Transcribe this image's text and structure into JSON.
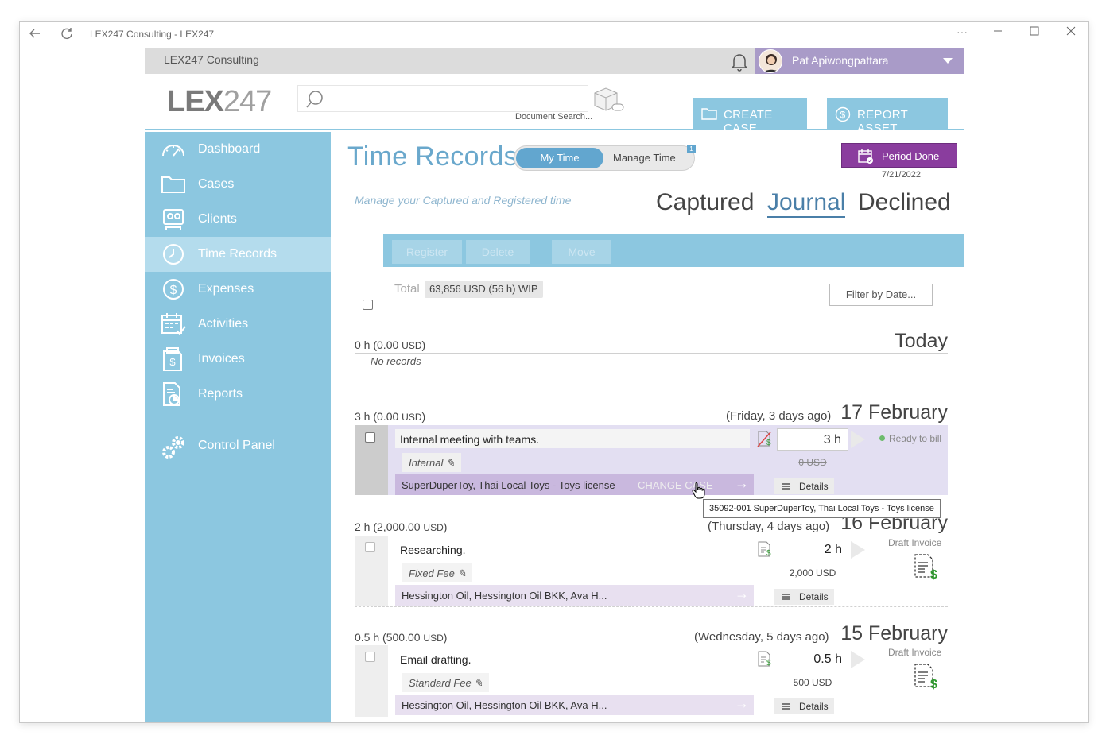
{
  "window": {
    "title": "LEX247 Consulting - LEX247"
  },
  "topbar": {
    "org": "LEX247 Consulting",
    "user": "Pat Apiwongpattara"
  },
  "header": {
    "logo_bold": "LEX",
    "logo_light": "247",
    "search_placeholder": "",
    "doc_search_label": "Document Search...",
    "create_case": "CREATE CASE",
    "report_asset": "REPORT ASSET"
  },
  "sidebar": {
    "items": [
      {
        "label": "Dashboard",
        "icon": "dashboard-icon"
      },
      {
        "label": "Cases",
        "icon": "folder-icon"
      },
      {
        "label": "Clients",
        "icon": "clients-icon"
      },
      {
        "label": "Time Records",
        "icon": "clock-icon"
      },
      {
        "label": "Expenses",
        "icon": "dollar-icon"
      },
      {
        "label": "Activities",
        "icon": "calendar-icon"
      },
      {
        "label": "Invoices",
        "icon": "invoice-icon"
      },
      {
        "label": "Reports",
        "icon": "report-icon"
      },
      {
        "label": "Control Panel",
        "icon": "gears-icon"
      }
    ],
    "active": "Time Records"
  },
  "page": {
    "title": "Time Records",
    "toggle_on": "My Time",
    "toggle_off": "Manage Time",
    "toggle_badge": "1",
    "subtitle": "Manage your Captured and Registered time",
    "tabs": [
      "Captured",
      "Journal",
      "Declined"
    ],
    "active_tab": "Journal",
    "period_done": "Period Done",
    "period_date": "7/21/2022"
  },
  "actions": {
    "register": "Register",
    "delete": "Delete",
    "move": "Move"
  },
  "summary": {
    "total_label": "Total",
    "total_value": "63,856 USD (56 h)  WIP",
    "filter": "Filter by Date..."
  },
  "groups": [
    {
      "hours": "0 h",
      "amount": "(0.00 ",
      "currency": "USD",
      "close": ")",
      "relative": "",
      "date": "Today",
      "empty": "No records"
    },
    {
      "hours": "3 h",
      "amount": "(0.00 ",
      "currency": "USD",
      "close": ")",
      "relative": "(Friday, 3 days ago)",
      "date": "17 February"
    },
    {
      "hours": "2 h",
      "amount": "(2,000.00 ",
      "currency": "USD",
      "close": ")",
      "relative": "(Thursday, 4 days ago)",
      "date": "16 February"
    },
    {
      "hours": "0.5 h",
      "amount": "(500.00 ",
      "currency": "USD",
      "close": ")",
      "relative": "(Wednesday, 5 days ago)",
      "date": "15 February"
    }
  ],
  "records": [
    {
      "desc": "Internal meeting with teams.",
      "tag": "Internal",
      "case": "SuperDuperToy, Thai Local Toys - Toys license",
      "case_action": "CHANGE CASE",
      "hours": "3 h",
      "amount": "0 USD",
      "status": "Ready to bill",
      "details": "Details"
    },
    {
      "desc": "Researching.",
      "tag": "Fixed Fee",
      "case": "Hessington Oil, Hessington Oil BKK, Ava H...",
      "hours": "2 h",
      "amount": "2,000 USD",
      "status": "Draft Invoice",
      "details": "Details"
    },
    {
      "desc": "Email drafting.",
      "tag": "Standard Fee",
      "case": "Hessington Oil, Hessington Oil BKK, Ava H...",
      "hours": "0.5 h",
      "amount": "500 USD",
      "status": "Draft Invoice",
      "details": "Details"
    }
  ],
  "tooltip": "35092-001 SuperDuperToy, Thai Local Toys - Toys license",
  "colors": {
    "sidebar": "#8cc7e0",
    "accent": "#62a6cf",
    "period_done": "#8a3d9e",
    "user_bar": "#a99bc8"
  }
}
